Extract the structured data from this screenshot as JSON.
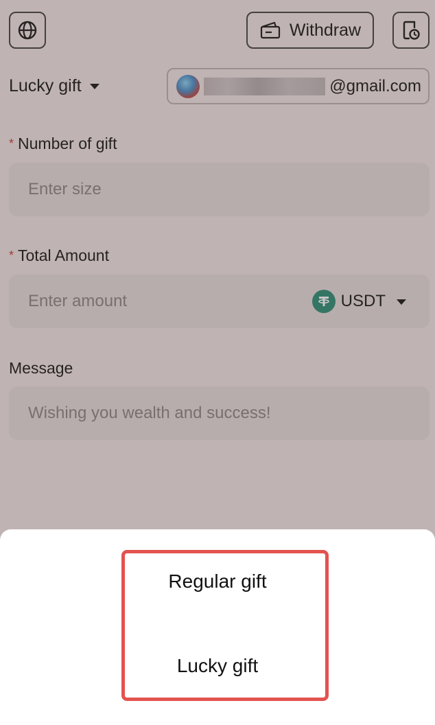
{
  "header": {
    "language_icon": "globe-icon",
    "withdraw_label": "Withdraw",
    "withdraw_icon": "wallet-icon",
    "history_icon": "record-icon"
  },
  "gift_selector": {
    "selected": "Lucky gift"
  },
  "account": {
    "email_suffix": "@gmail.com"
  },
  "form": {
    "number_of_gift": {
      "label": "Number of gift",
      "required_mark": "*",
      "placeholder": "Enter size"
    },
    "total_amount": {
      "label": "Total Amount",
      "required_mark": "*",
      "placeholder": "Enter amount",
      "currency": "USDT",
      "currency_icon": "tether-icon"
    },
    "message": {
      "label": "Message",
      "placeholder": "Wishing you wealth and success!"
    }
  },
  "sheet": {
    "options": [
      "Regular gift",
      "Lucky gift"
    ]
  },
  "colors": {
    "required": "#c9413c",
    "highlight": "#e35350",
    "tether": "#2e8e77"
  }
}
